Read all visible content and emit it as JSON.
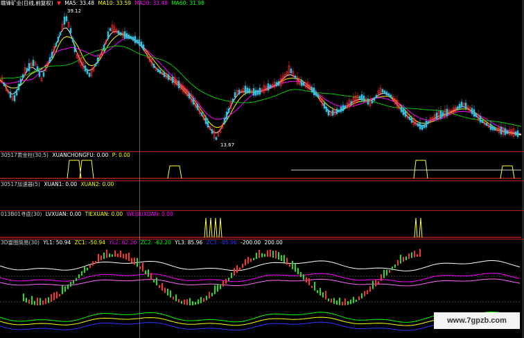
{
  "main": {
    "title": "赣锋矿业(日线,前复权)",
    "ma": [
      {
        "label": "MA5: 33.48",
        "color": "#ffffff"
      },
      {
        "label": "MA10: 33.59",
        "color": "#ffff00"
      },
      {
        "label": "MA20: 33.48",
        "color": "#ff00ff"
      },
      {
        "label": "MA60: 31.98",
        "color": "#00ff00"
      }
    ],
    "high_label": "39.12",
    "low_label": "13.67"
  },
  "panel1": {
    "name": "30517黄金柱(30,5)",
    "items": [
      {
        "label": "XUANCHONGFU: 0.00",
        "color": "#ffffff"
      },
      {
        "label": "P: 0.00",
        "color": "#ffff00"
      }
    ]
  },
  "panel2": {
    "name": "30517加速器(5)",
    "items": [
      {
        "label": "XUAN1: 0.00",
        "color": "#ffffff"
      },
      {
        "label": "XUAN2: 0.00",
        "color": "#ffff00"
      }
    ]
  },
  "panel3": {
    "name": "013B01寻底(30)",
    "items": [
      {
        "label": "LVXUAN: 0.00",
        "color": "#ffffff"
      },
      {
        "label": "TIEXUAN: 0.00",
        "color": "#ffff00"
      },
      {
        "label": "WEIJIUXUAN: 0.00",
        "color": "#ff00ff"
      }
    ]
  },
  "panel4": {
    "name": "3D雷图简易(30)",
    "items": [
      {
        "label": "YL1: 50.94",
        "color": "#ffffff"
      },
      {
        "label": "ZC1: -50.94",
        "color": "#ffff00"
      },
      {
        "label": "YL2: 62.20",
        "color": "#ff00ff"
      },
      {
        "label": "ZC2: -62.20",
        "color": "#00ff00"
      },
      {
        "label": "YL3: 85.96",
        "color": "#ffffff"
      },
      {
        "label": "ZC3: -85.96",
        "color": "#3333ff"
      },
      {
        "label": "-200.00",
        "color": "#ffffff"
      },
      {
        "label": "200.00",
        "color": "#ffffff"
      }
    ]
  },
  "watermark": "www.7gpzb.com",
  "colors": {
    "up": "#ff3030",
    "down": "#20e020",
    "separator": "#b01e1e"
  }
}
